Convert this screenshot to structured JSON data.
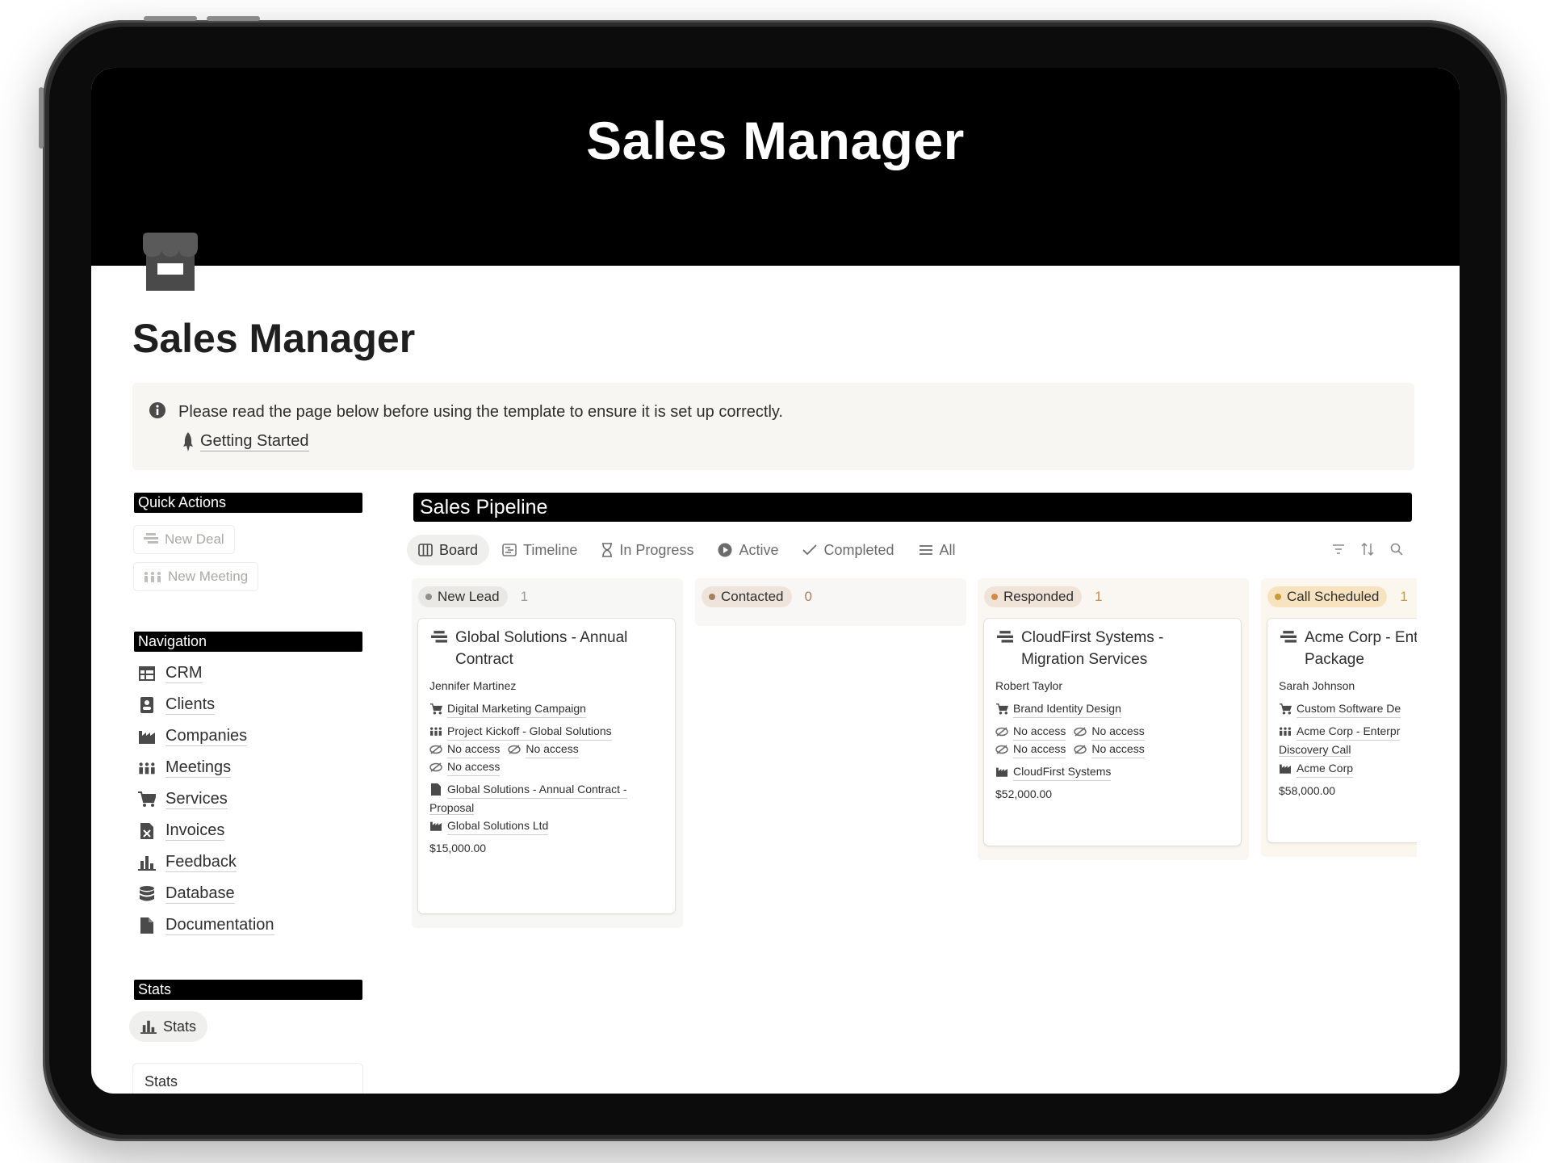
{
  "cover": {
    "title": "Sales Manager"
  },
  "page": {
    "title": "Sales Manager"
  },
  "callout": {
    "text": "Please read the page below before using the template to ensure it is set up correctly.",
    "link_label": "Getting Started"
  },
  "quick_actions": {
    "title": "Quick Actions",
    "buttons": [
      {
        "label": "New Deal"
      },
      {
        "label": "New Meeting"
      }
    ]
  },
  "navigation": {
    "title": "Navigation",
    "items": [
      {
        "label": "CRM",
        "icon": "table-icon"
      },
      {
        "label": "Clients",
        "icon": "contact-card-icon"
      },
      {
        "label": "Companies",
        "icon": "factory-icon"
      },
      {
        "label": "Meetings",
        "icon": "group-icon"
      },
      {
        "label": "Services",
        "icon": "cart-icon"
      },
      {
        "label": "Invoices",
        "icon": "invoice-icon"
      },
      {
        "label": "Feedback",
        "icon": "bar-chart-icon"
      },
      {
        "label": "Database",
        "icon": "database-icon"
      },
      {
        "label": "Documentation",
        "icon": "document-icon"
      }
    ]
  },
  "stats": {
    "title": "Stats",
    "chip_label": "Stats",
    "card_title": "Stats"
  },
  "pipeline": {
    "title": "Sales Pipeline",
    "tabs": [
      {
        "label": "Board",
        "icon": "board-icon",
        "active": true
      },
      {
        "label": "Timeline",
        "icon": "timeline-icon"
      },
      {
        "label": "In Progress",
        "icon": "hourglass-icon"
      },
      {
        "label": "Active",
        "icon": "play-icon"
      },
      {
        "label": "Completed",
        "icon": "check-icon"
      },
      {
        "label": "All",
        "icon": "list-icon"
      }
    ],
    "columns": [
      {
        "name": "New Lead",
        "count": "1",
        "pill_color": "#e9e8e5",
        "dot_color": "#8f8f8c",
        "count_color": "#9b9a97",
        "card": {
          "title_line1": "Global Solutions - Annual",
          "title_line2": "Contract",
          "contact": "Jennifer Martinez",
          "service": "Digital Marketing Campaign",
          "meeting": "Project Kickoff - Global Solutions",
          "no_access": "No access",
          "proposal_line1": "Global Solutions - Annual Contract -",
          "proposal_line2": "Proposal",
          "company": "Global Solutions Ltd",
          "amount": "$15,000.00"
        }
      },
      {
        "name": "Contacted",
        "count": "0",
        "pill_color": "#eee4dc",
        "dot_color": "#a6805f",
        "count_color": "#a6805f"
      },
      {
        "name": "Responded",
        "count": "1",
        "pill_color": "#f0e4d9",
        "dot_color": "#d28b47",
        "count_color": "#cc8b4e",
        "card": {
          "title_line1": "CloudFirst Systems -",
          "title_line2": "Migration Services",
          "contact": "Robert Taylor",
          "service": "Brand Identity Design",
          "no_access": "No access",
          "company": "CloudFirst Systems",
          "amount": "$52,000.00"
        }
      },
      {
        "name": "Call Scheduled",
        "count": "1",
        "pill_color": "#f7e3bf",
        "dot_color": "#c89a3a",
        "count_color": "#c89a3a",
        "card": {
          "title_line1": "Acme Corp - Ent",
          "title_line2": "Package",
          "contact": "Sarah Johnson",
          "service": "Custom Software De",
          "meeting_line1": "Acme Corp - Enterpr",
          "meeting_line2": "Discovery Call",
          "company": "Acme Corp",
          "amount": "$58,000.00"
        }
      }
    ]
  }
}
